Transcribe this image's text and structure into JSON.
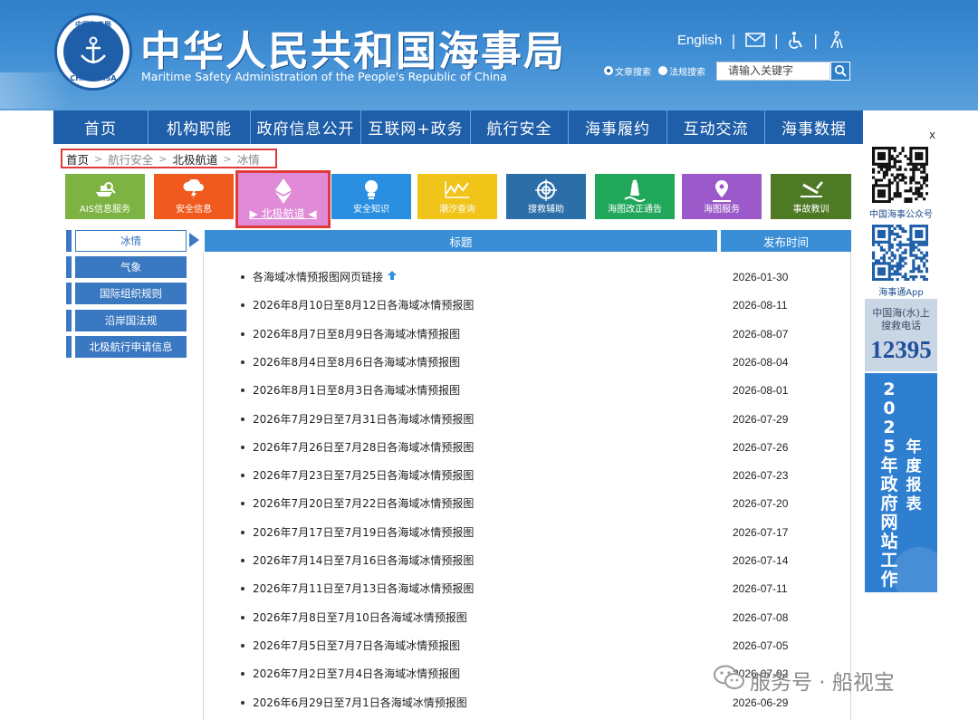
{
  "header": {
    "site_title": "中华人民共和国海事局",
    "site_subtitle": "Maritime Safety Administration of the People's Republic of China",
    "logo_text_top": "中国海事局",
    "logo_text_bottom": "CHINA MSA",
    "english_link": "English",
    "search": {
      "options": [
        "文章搜索",
        "法规搜索"
      ],
      "selected": "文章搜索",
      "placeholder": "请输入关键字"
    }
  },
  "nav": {
    "items": [
      "首页",
      "机构职能",
      "政府信息公开",
      "互联网+政务",
      "航行安全",
      "海事履约",
      "互动交流",
      "海事数据"
    ]
  },
  "breadcrumb": [
    "首页",
    "航行安全",
    "北极航道",
    "冰情"
  ],
  "tiles": [
    {
      "label": "AIS信息服务",
      "color": "#7cb342",
      "icon": "ship-search-icon"
    },
    {
      "label": "安全信息",
      "color": "#f05a1e",
      "icon": "cloud-lightning-icon"
    },
    {
      "label": "北极航道",
      "color": "#e08ad8",
      "icon": "diamond-icon",
      "active": true
    },
    {
      "label": "安全知识",
      "color": "#2a8fe0",
      "icon": "lightbulb-icon"
    },
    {
      "label": "潮汐查询",
      "color": "#f0c419",
      "icon": "tide-chart-icon"
    },
    {
      "label": "搜救辅助",
      "color": "#2c6ea7",
      "icon": "target-icon"
    },
    {
      "label": "海图改正通告",
      "color": "#21a75a",
      "icon": "buoy-icon"
    },
    {
      "label": "海图服务",
      "color": "#9b59c9",
      "icon": "map-pin-icon"
    },
    {
      "label": "事故教训",
      "color": "#4e7a26",
      "icon": "wrench-icon"
    }
  ],
  "sidebar": {
    "items": [
      "冰情",
      "气象",
      "国际组织规则",
      "沿岸国法规",
      "北极航行申请信息"
    ],
    "active": "冰情"
  },
  "table": {
    "headers": {
      "title": "标题",
      "date": "发布时间"
    },
    "rows": [
      {
        "title": "各海域冰情预报图网页链接",
        "date": "2026-01-30",
        "pinned": true
      },
      {
        "title": "2026年8月10日至8月12日各海域冰情预报图",
        "date": "2026-08-11"
      },
      {
        "title": "2026年8月7日至8月9日各海域冰情预报图",
        "date": "2026-08-07"
      },
      {
        "title": "2026年8月4日至8月6日各海域冰情预报图",
        "date": "2026-08-04"
      },
      {
        "title": "2026年8月1日至8月3日各海域冰情预报图",
        "date": "2026-08-01"
      },
      {
        "title": "2026年7月29日至7月31日各海域冰情预报图",
        "date": "2026-07-29"
      },
      {
        "title": "2026年7月26日至7月28日各海域冰情预报图",
        "date": "2026-07-26"
      },
      {
        "title": "2026年7月23日至7月25日各海域冰情预报图",
        "date": "2026-07-23"
      },
      {
        "title": "2026年7月20日至7月22日各海域冰情预报图",
        "date": "2026-07-20"
      },
      {
        "title": "2026年7月17日至7月19日各海域冰情预报图",
        "date": "2026-07-17"
      },
      {
        "title": "2026年7月14日至7月16日各海域冰情预报图",
        "date": "2026-07-14"
      },
      {
        "title": "2026年7月11日至7月13日各海域冰情预报图",
        "date": "2026-07-11"
      },
      {
        "title": "2026年7月8日至7月10日各海域冰情预报图",
        "date": "2026-07-08"
      },
      {
        "title": "2026年7月5日至7月7日各海域冰情预报图",
        "date": "2026-07-05"
      },
      {
        "title": "2026年7月2日至7月4日各海域冰情预报图",
        "date": "2026-07-02"
      },
      {
        "title": "2026年6月29日至7月1日各海域冰情预报图",
        "date": "2026-06-29"
      }
    ]
  },
  "right_panel": {
    "close_label": "x",
    "qr1_label": "中国海事公众号",
    "qr2_label": "海事通App",
    "rescue_line1": "中国海(水)上",
    "rescue_line2": "搜救电话",
    "rescue_number": "12395",
    "report_year": "2025年政府网站工作",
    "report_title": "年度报表"
  },
  "watermark": {
    "text": "服务号 · 船视宝"
  },
  "colors": {
    "header_blue": "#2f7fc9",
    "nav_blue": "#1f5ea8",
    "table_header": "#3a8ed6",
    "highlight_red": "#e03b3b"
  }
}
